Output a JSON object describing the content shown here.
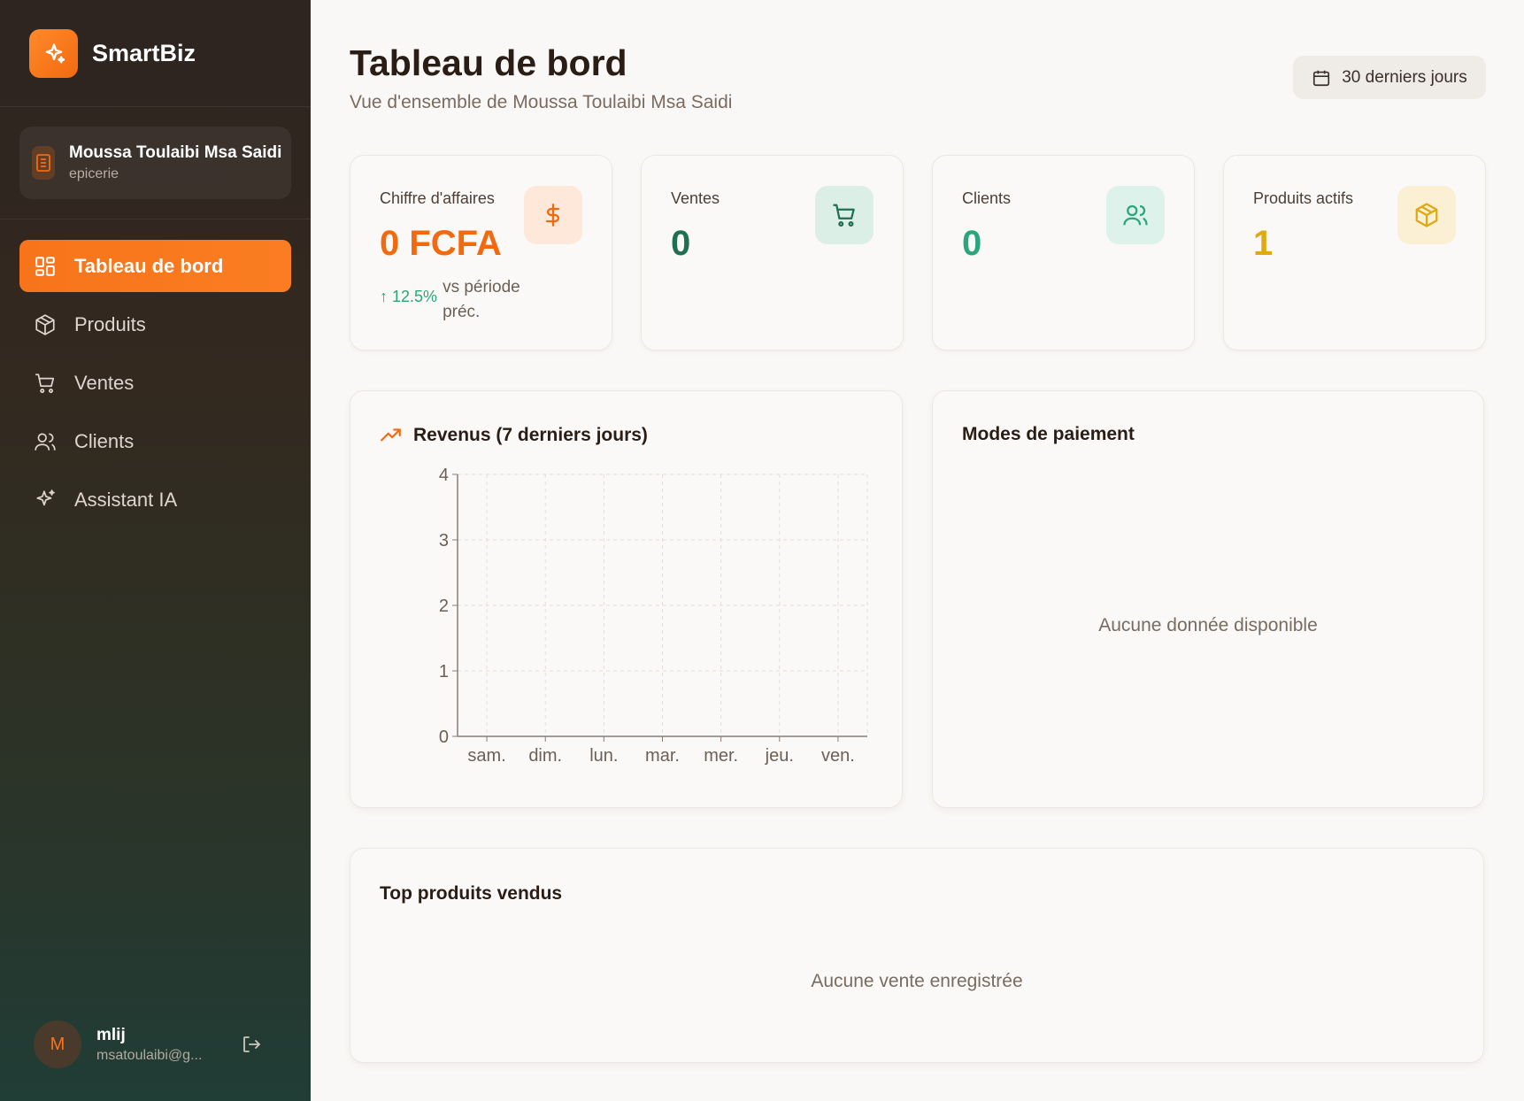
{
  "brand": {
    "name": "SmartBiz",
    "icon": "sparkles-icon"
  },
  "store": {
    "name": "Moussa Toulaibi Msa Saidi",
    "type": "epicerie",
    "icon": "building-icon"
  },
  "nav": {
    "items": [
      {
        "label": "Tableau de bord",
        "icon": "dashboard-grid-icon",
        "active": true
      },
      {
        "label": "Produits",
        "icon": "package-icon",
        "active": false
      },
      {
        "label": "Ventes",
        "icon": "cart-icon",
        "active": false
      },
      {
        "label": "Clients",
        "icon": "users-icon",
        "active": false
      },
      {
        "label": "Assistant IA",
        "icon": "sparkles-icon",
        "active": false
      }
    ]
  },
  "user": {
    "initial": "M",
    "name": "mlij",
    "email": "msatoulaibi@g...",
    "logout_icon": "logout-icon"
  },
  "header": {
    "title": "Tableau de bord",
    "subtitle": "Vue d'ensemble de Moussa Toulaibi Msa Saidi",
    "period": "30 derniers jours"
  },
  "kpis": [
    {
      "label": "Chiffre d'affaires",
      "value": "0 FCFA",
      "icon": "dollar-icon",
      "color": "#f26a0f",
      "icon_bg": "#fde8d9",
      "trend": {
        "arrow": "↑",
        "value": "12.5%",
        "text": "vs période préc."
      }
    },
    {
      "label": "Ventes",
      "value": "0",
      "icon": "cart-icon",
      "color": "#1f6f52",
      "icon_bg": "#dcefe7"
    },
    {
      "label": "Clients",
      "value": "0",
      "icon": "users-icon",
      "color": "#2aa57d",
      "icon_bg": "#dcf2ea"
    },
    {
      "label": "Produits actifs",
      "value": "1",
      "icon": "package-icon",
      "color": "#e0a912",
      "icon_bg": "#fbf0d3"
    }
  ],
  "revenue_card": {
    "title": "Revenus (7 derniers jours)",
    "icon": "trending-up-icon"
  },
  "payment_card": {
    "title": "Modes de paiement",
    "empty": "Aucune donnée disponible"
  },
  "top_products_card": {
    "title": "Top produits vendus",
    "empty": "Aucune vente enregistrée"
  },
  "colors": {
    "accent": "#f7741a",
    "sidebar_top": "#2e2420",
    "sidebar_bottom": "#203d36"
  },
  "chart_data": {
    "type": "line",
    "title": "Revenus (7 derniers jours)",
    "categories": [
      "sam.",
      "dim.",
      "lun.",
      "mar.",
      "mer.",
      "jeu.",
      "ven."
    ],
    "series": [],
    "ylim": [
      0,
      4
    ],
    "yticks": [
      0,
      1,
      2,
      3,
      4
    ],
    "grid": true
  }
}
